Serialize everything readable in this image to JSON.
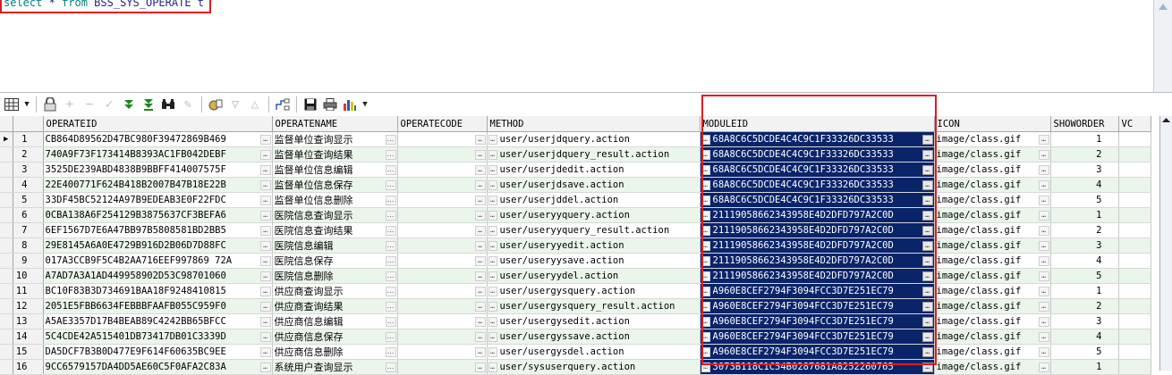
{
  "editor": {
    "sql_keyword_select": "select",
    "sql_star": " * ",
    "sql_keyword_from": "from",
    "sql_table": " BSS_SYS_OPERATE t"
  },
  "toolbar": {
    "icons": [
      "grid-view-icon",
      "dropdown-icon",
      "lock-icon",
      "add-record-icon",
      "delete-record-icon",
      "post-record-icon",
      "fetch-next-icon",
      "fetch-last-icon",
      "find-icon",
      "clear-icon",
      "query-by-example-icon",
      "filter-icon",
      "sort-icon",
      "export-icon",
      "save-icon",
      "print-icon",
      "chart-icon",
      "dropdown-icon"
    ]
  },
  "grid": {
    "columns": [
      "OPERATEID",
      "OPERATENAME",
      "OPERATECODE",
      "METHOD",
      "MODULEID",
      "ICON",
      "SHOWORDER",
      "VC"
    ],
    "rows": [
      {
        "n": "1",
        "id": "CB864D89562D47BC980F39472869B469",
        "name": "监督单位查询显示",
        "code": "",
        "method": "user/userjdquery.action",
        "module": "68A8C6C5DCDE4C4C9C1F33326DC33533",
        "icon": "image/class.gif",
        "order": "1"
      },
      {
        "n": "2",
        "id": "740A9F73F173414B8393AC1FB042DEBF",
        "name": "监督单位查询结果",
        "code": "",
        "method": "user/userjdquery_result.action",
        "module": "68A8C6C5DCDE4C4C9C1F33326DC33533",
        "icon": "image/class.gif",
        "order": "2"
      },
      {
        "n": "3",
        "id": "3525DE239ABD4838B9BBFF414007575F",
        "name": "监督单位信息编辑",
        "code": "",
        "method": "user/userjdedit.action",
        "module": "68A8C6C5DCDE4C4C9C1F33326DC33533",
        "icon": "image/class.gif",
        "order": "3"
      },
      {
        "n": "4",
        "id": "22E400771F624B418B2007B47B18E22B",
        "name": "监督单位信息保存",
        "code": "",
        "method": "user/userjdsave.action",
        "module": "68A8C6C5DCDE4C4C9C1F33326DC33533",
        "icon": "image/class.gif",
        "order": "4"
      },
      {
        "n": "5",
        "id": "33DF45BC52124A97B9EDEAB3E0F22FDC",
        "name": "监督单位信息删除",
        "code": "",
        "method": "user/userjddel.action",
        "module": "68A8C6C5DCDE4C4C9C1F33326DC33533",
        "icon": "image/class.gif",
        "order": "5"
      },
      {
        "n": "6",
        "id": "0CBA138A6F254129B3875637CF3BEFA6",
        "name": "医院信息查询显示",
        "code": "",
        "method": "user/useryyquery.action",
        "module": "21119058662343958E4D2DFD797A2C0D",
        "icon": "image/class.gif",
        "order": "1"
      },
      {
        "n": "7",
        "id": "6EF1567D7E6A47BB97B5808581BD2BB5",
        "name": "医院信息查询结果",
        "code": "",
        "method": "user/useryyquery_result.action",
        "module": "21119058662343958E4D2DFD797A2C0D",
        "icon": "image/class.gif",
        "order": "2"
      },
      {
        "n": "8",
        "id": "29E8145A6A0E4729B916D2B06D7D88FC",
        "name": "医院信息编辑",
        "code": "",
        "method": "user/useryyedit.action",
        "module": "21119058662343958E4D2DFD797A2C0D",
        "icon": "image/class.gif",
        "order": "3"
      },
      {
        "n": "9",
        "id": "017A3CCB9F5C4B2AA716EEF997869 72A",
        "name": "医院信息保存",
        "code": "",
        "method": "user/useryysave.action",
        "module": "21119058662343958E4D2DFD797A2C0D",
        "icon": "image/class.gif",
        "order": "4"
      },
      {
        "n": "10",
        "id": "A7AD7A3A1AD449958902D53C98701060",
        "name": "医院信息删除",
        "code": "",
        "method": "user/useryydel.action",
        "module": "21119058662343958E4D2DFD797A2C0D",
        "icon": "image/class.gif",
        "order": "5"
      },
      {
        "n": "11",
        "id": "BC10F83B3D734691BAA18F9248410815",
        "name": "供应商查询显示",
        "code": "",
        "method": "user/usergysquery.action",
        "module": "A960E8CEF2794F3094FCC3D7E251EC79",
        "icon": "image/class.gif",
        "order": "1"
      },
      {
        "n": "12",
        "id": "2051E5FBB6634FEBBBFAAFB055C959F0",
        "name": "供应商查询结果",
        "code": "",
        "method": "user/usergysquery_result.action",
        "module": "A960E8CEF2794F3094FCC3D7E251EC79",
        "icon": "image/class.gif",
        "order": "2"
      },
      {
        "n": "13",
        "id": "A5AE3357D17B4BEAB89C4242BB65BFCC",
        "name": "供应商信息编辑",
        "code": "",
        "method": "user/usergysedit.action",
        "module": "A960E8CEF2794F3094FCC3D7E251EC79",
        "icon": "image/class.gif",
        "order": "3"
      },
      {
        "n": "14",
        "id": "5C4CDE42A515401DB73417DB01C3339D",
        "name": "供应商信息保存",
        "code": "",
        "method": "user/usergyssave.action",
        "module": "A960E8CEF2794F3094FCC3D7E251EC79",
        "icon": "image/class.gif",
        "order": "4"
      },
      {
        "n": "15",
        "id": "DA5DCF7B3B0D477E9F614F60635BC9EE",
        "name": "供应商信息删除",
        "code": "",
        "method": "user/usergysdel.action",
        "module": "A960E8CEF2794F3094FCC3D7E251EC79",
        "icon": "image/class.gif",
        "order": "5"
      },
      {
        "n": "16",
        "id": "9CC6579157DA4DD5AE60C5F0AFA2C83A",
        "name": "系统用户查询显示",
        "code": "",
        "method": "user/sysuserquery.action",
        "module": "3073B118C1C54B0287681A8252260765",
        "icon": "image/class.gif",
        "order": "1"
      }
    ]
  },
  "colors": {
    "selection": "#0a246a",
    "highlight_box": "#e8191c",
    "alt_row": "#eaf6ea"
  }
}
